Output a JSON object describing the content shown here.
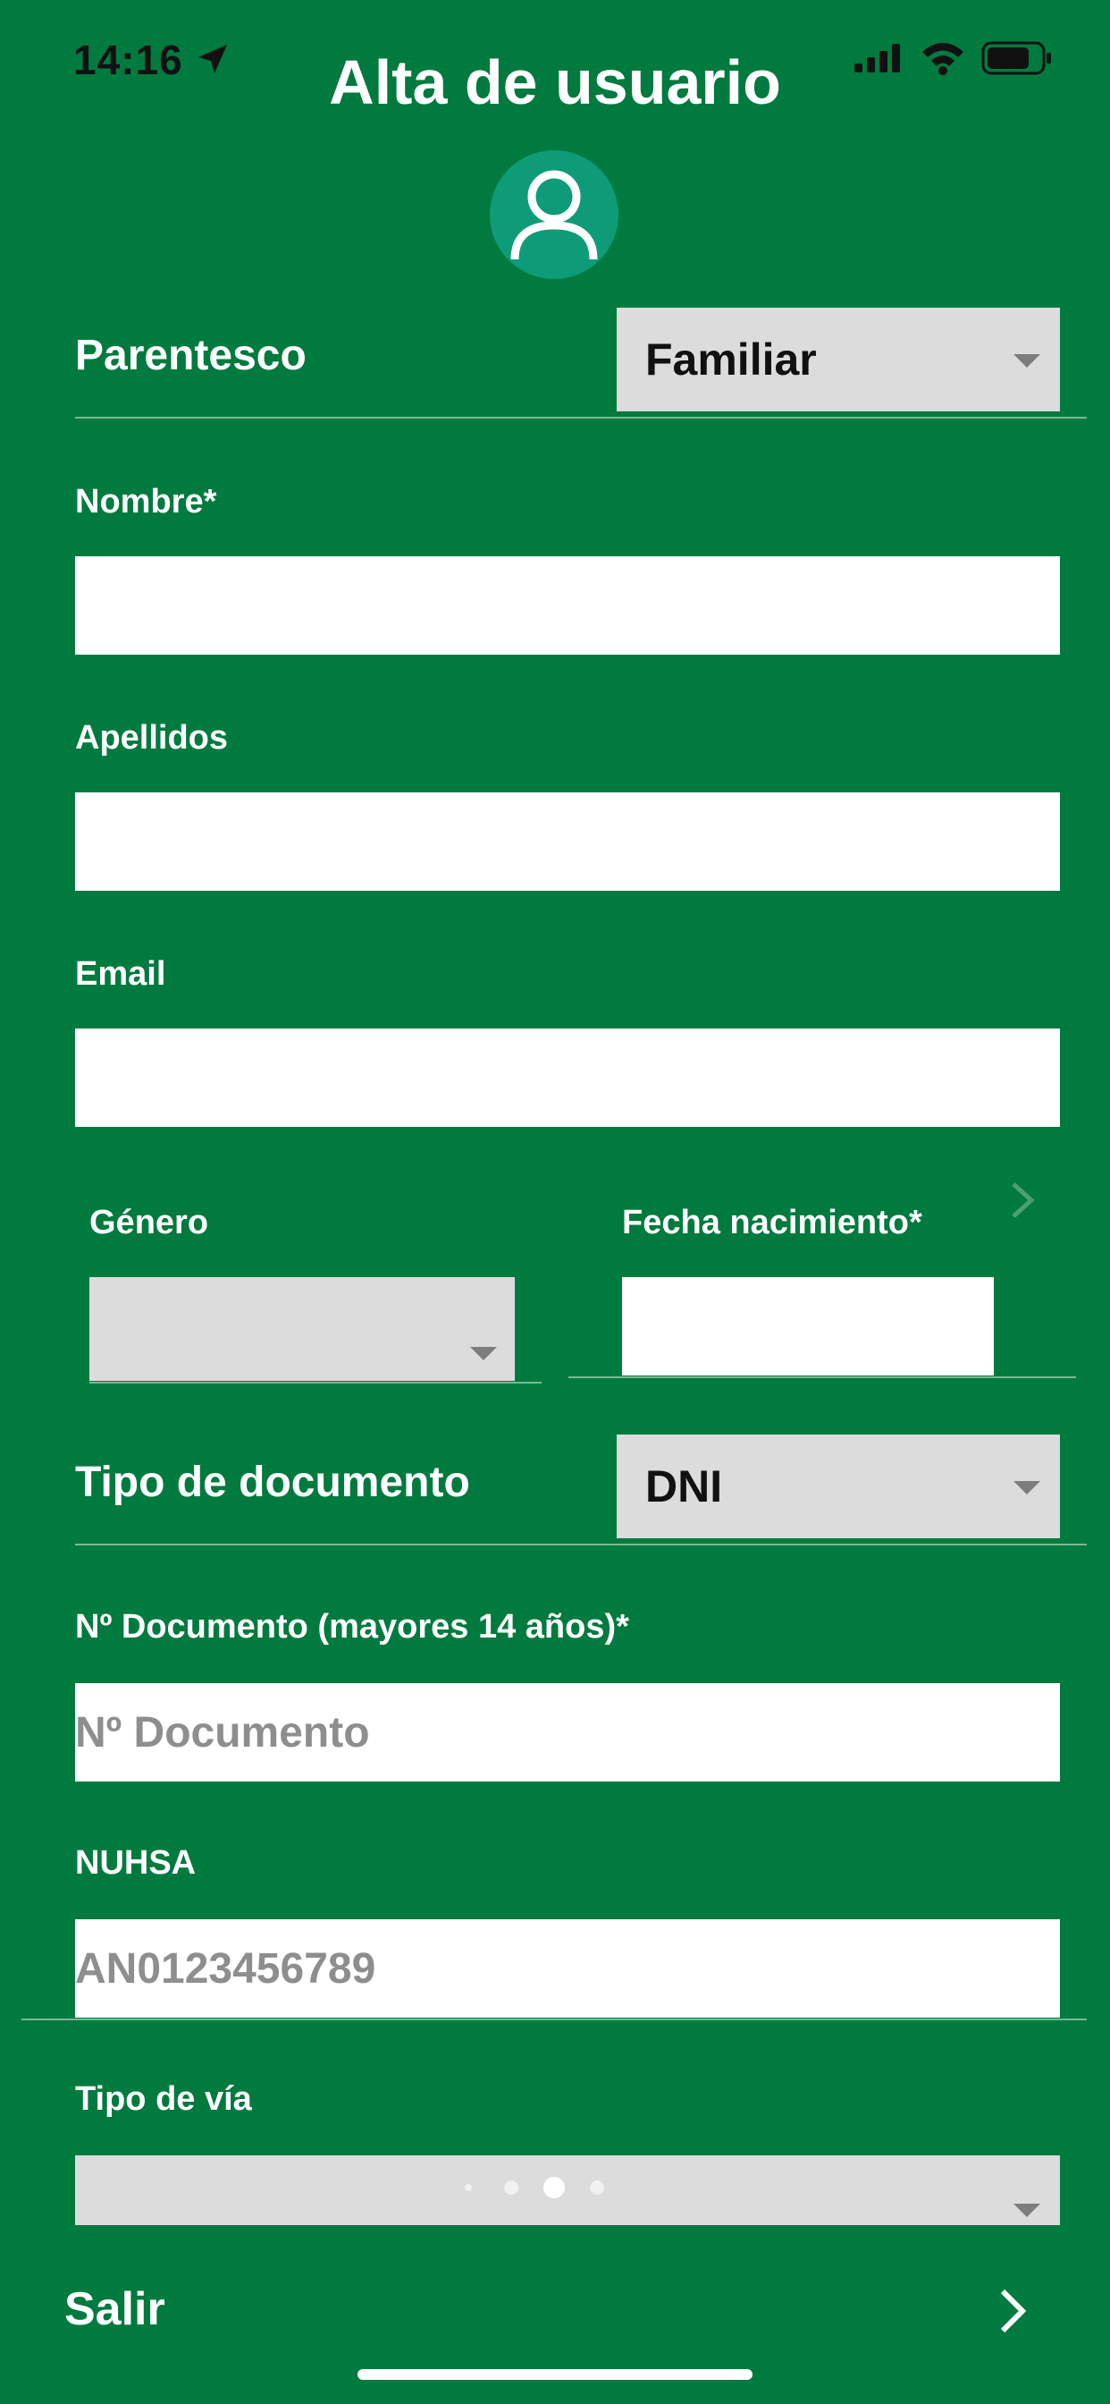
{
  "status_bar": {
    "time": "14:16",
    "icons": [
      "location-arrow-icon",
      "cellular-signal-icon",
      "wifi-icon",
      "battery-icon"
    ]
  },
  "header": {
    "title": "Alta de usuario",
    "avatar_icon": "user-icon"
  },
  "form": {
    "parentesco": {
      "label": "Parentesco",
      "value": "Familiar"
    },
    "nombre": {
      "label": "Nombre*",
      "value": ""
    },
    "apellidos": {
      "label": "Apellidos",
      "value": ""
    },
    "email": {
      "label": "Email",
      "value": ""
    },
    "genero": {
      "label": "Género",
      "value": ""
    },
    "fecha_nacimiento": {
      "label": "Fecha nacimiento*",
      "value": ""
    },
    "tipo_documento": {
      "label": "Tipo de documento",
      "value": "DNI"
    },
    "num_documento": {
      "label": "Nº Documento (mayores 14 años)*",
      "placeholder": "Nº Documento"
    },
    "nuhsa": {
      "label": "NUHSA",
      "placeholder": "AN0123456789"
    },
    "tipo_via": {
      "label": "Tipo de vía",
      "value": ""
    }
  },
  "pager": {
    "count": 4,
    "active_index": 2
  },
  "bottom_bar": {
    "exit_label": "Salir",
    "next_icon": "chevron-right-icon"
  },
  "colors": {
    "background": "#007a3e",
    "avatar": "#0e9b78",
    "select": "#dcdcdc"
  }
}
